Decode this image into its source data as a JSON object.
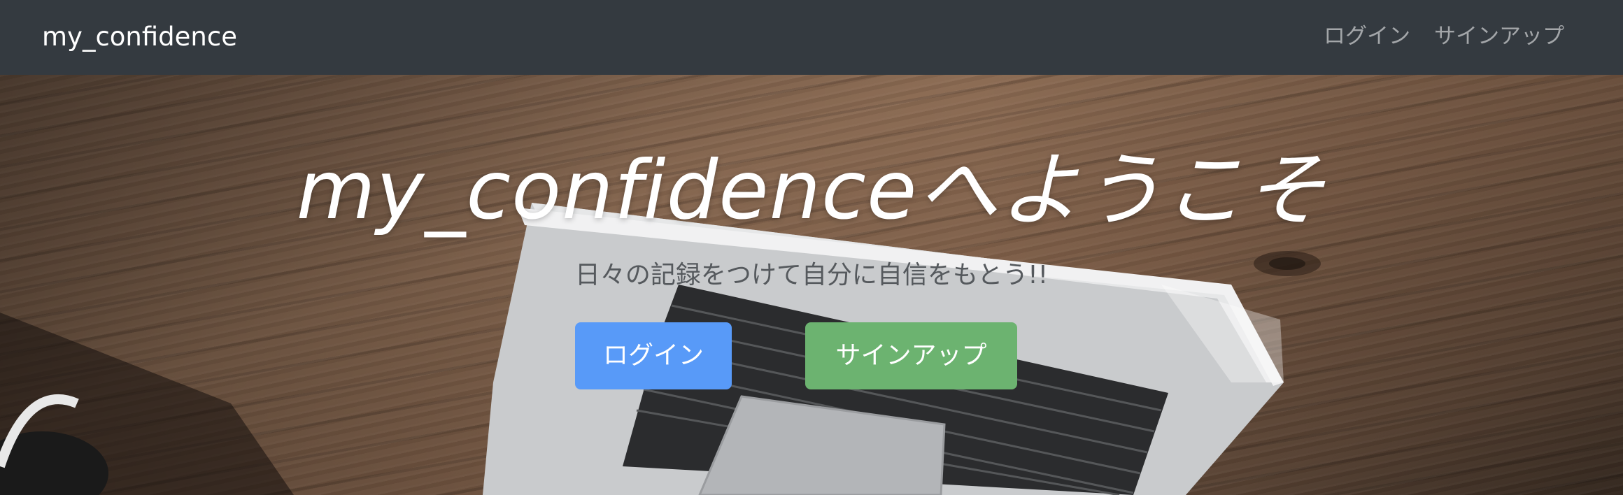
{
  "navbar": {
    "brand": "my_confidence",
    "links": [
      {
        "label": "ログイン"
      },
      {
        "label": "サインアップ"
      }
    ],
    "background_color": "#343a40"
  },
  "hero": {
    "title": "my_confidenceへようこそ",
    "subtitle": "日々の記録をつけて自分に自信をもとう!!",
    "buttons": [
      {
        "label": "ログイン",
        "color": "#589af8"
      },
      {
        "label": "サインアップ",
        "color": "#6cb370"
      }
    ],
    "background_image": "laptop-on-wooden-desk"
  }
}
